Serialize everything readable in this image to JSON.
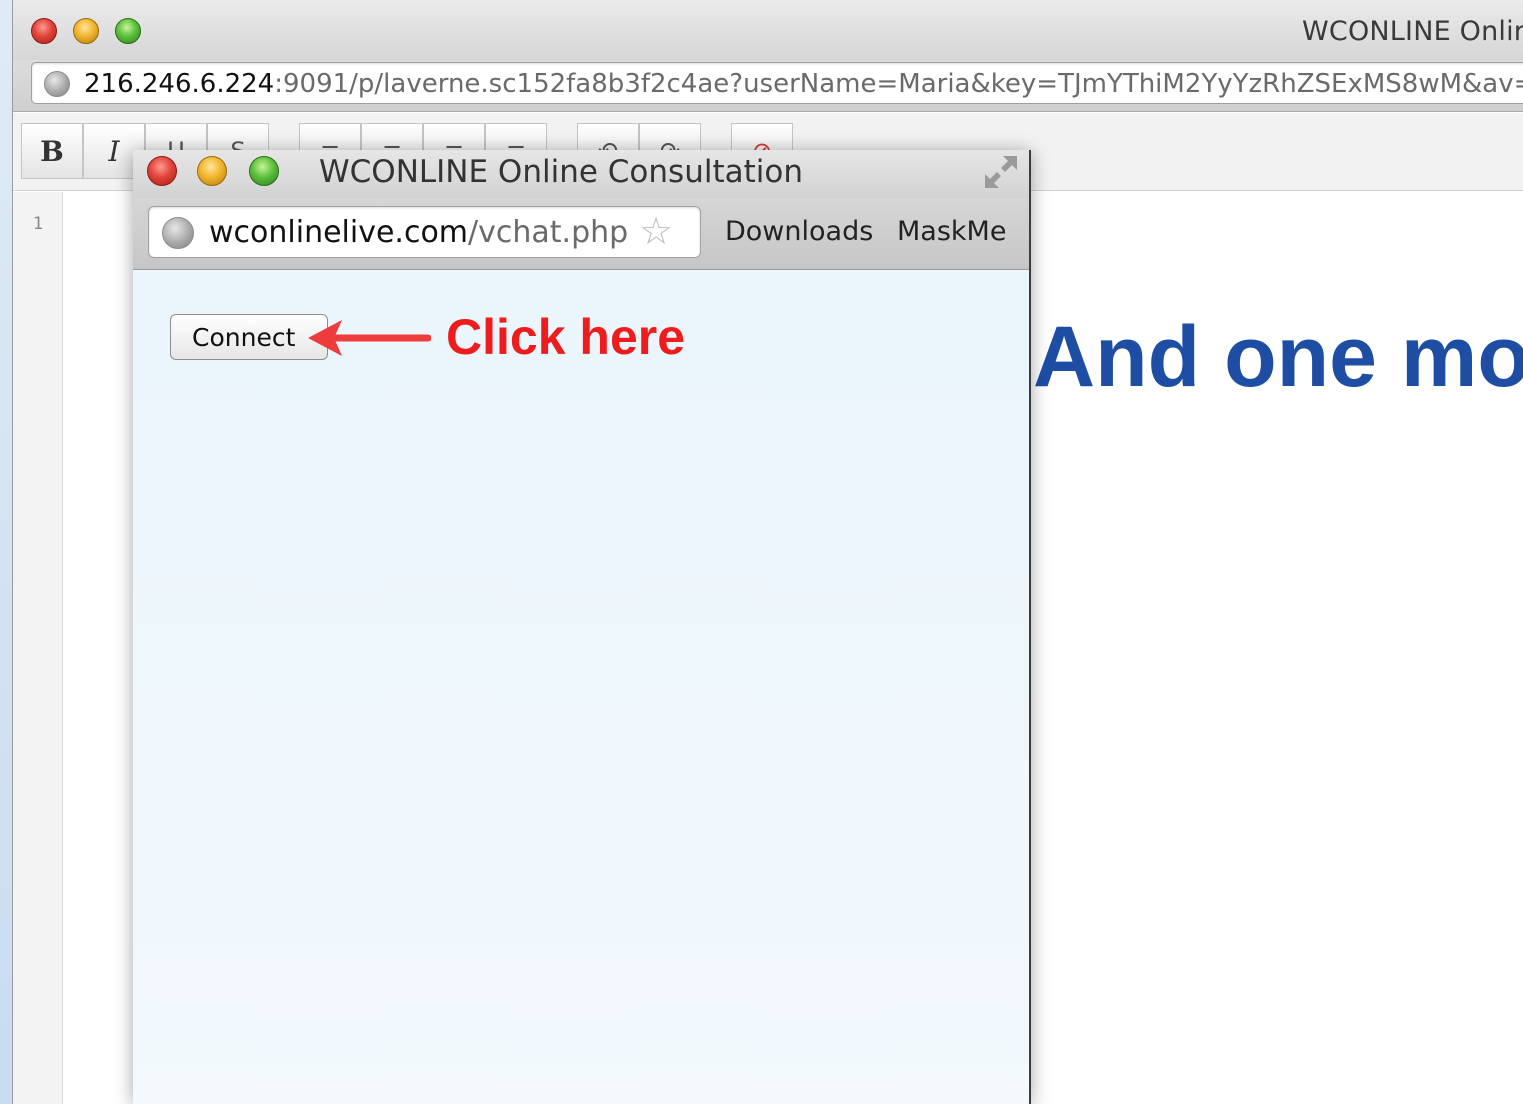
{
  "main_window": {
    "title": "WCONLINE Onlir",
    "url_host": "216.246.6.224",
    "url_rest": ":9091/p/laverne.sc152fa8b3f2c4ae?userName=Maria&key=TJmYThiM2YyYzRhZSExMS8wM&av=YES"
  },
  "editor": {
    "toolbar": {
      "bold_label": "B",
      "italic_label": "I"
    },
    "line_number": "1",
    "heading": "And one mo"
  },
  "popup": {
    "title": "WCONLINE Online Consultation",
    "url_host": "wconlinelive.com",
    "url_path": "/vchat.php",
    "toolbar_links": [
      "Downloads",
      "MaskMe"
    ],
    "connect_label": "Connect"
  },
  "annotation": {
    "text": "Click here",
    "color": "#ee1c1c"
  },
  "colors": {
    "heading": "#1e4ea4",
    "popup_bg": "#eef7fc"
  }
}
